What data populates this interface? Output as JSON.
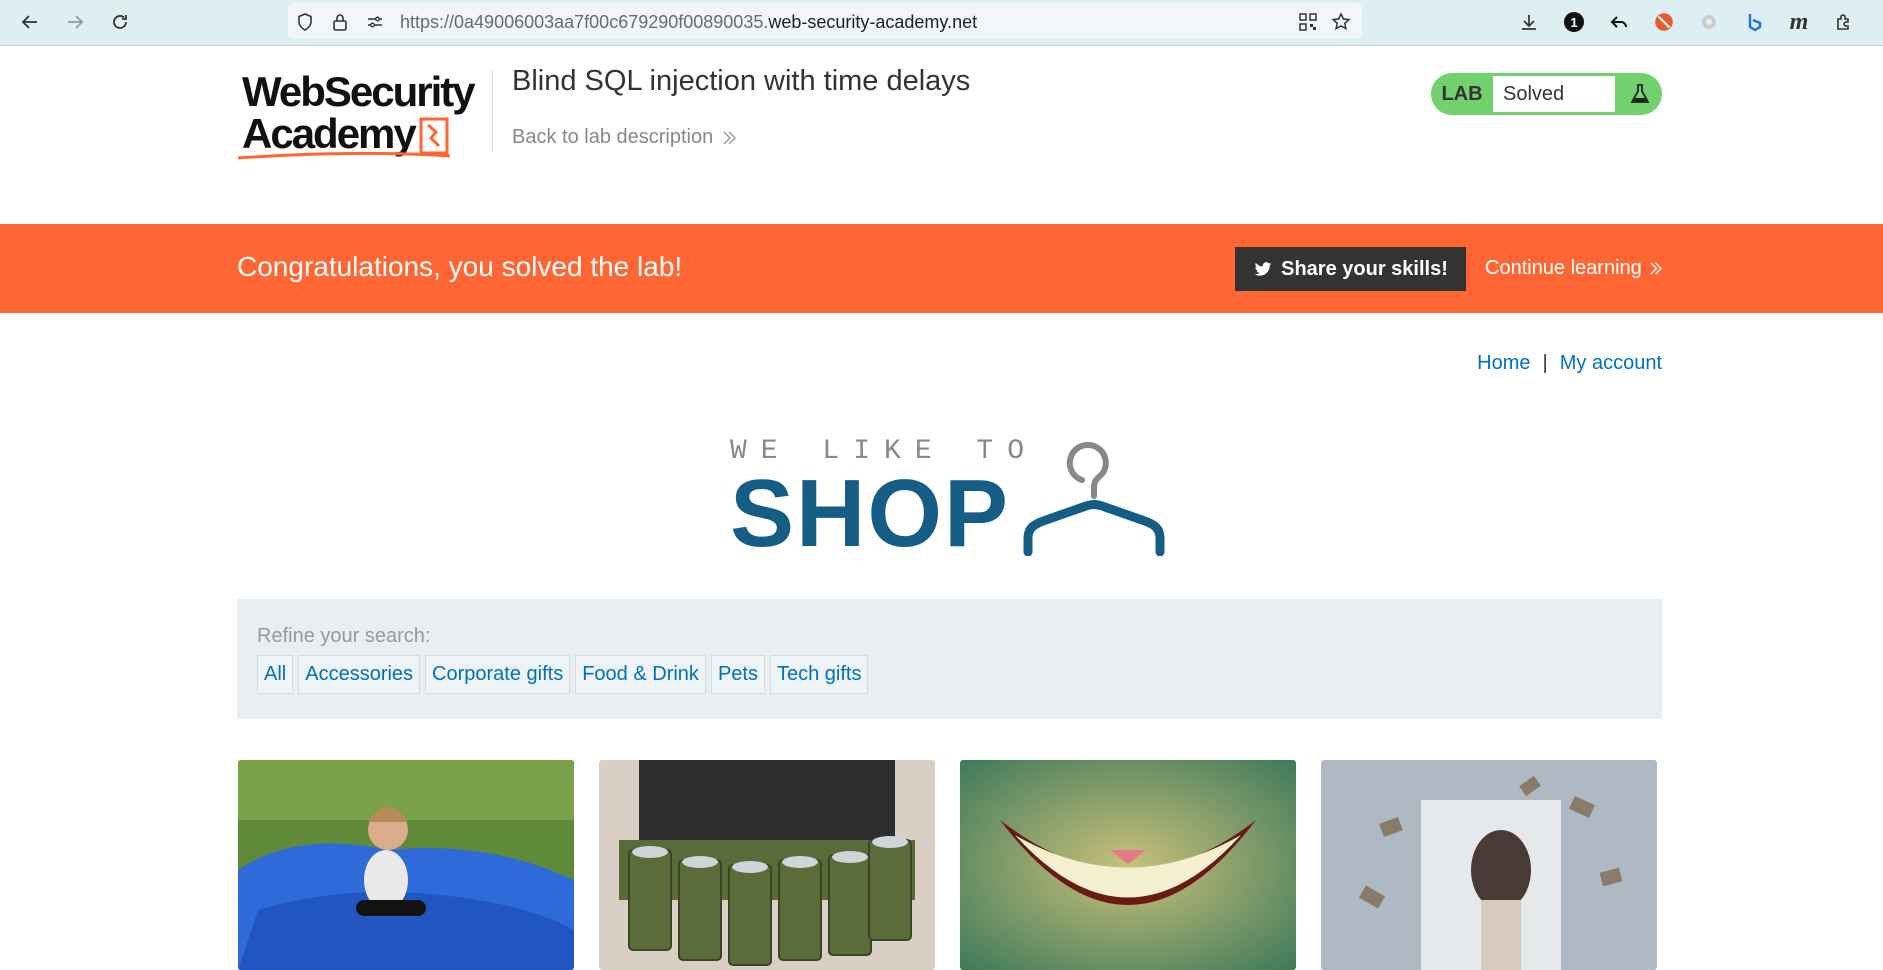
{
  "browser": {
    "url_prefix": "https://0a49006003aa7f00c679290f00890035.",
    "url_host": "web-security-academy.net",
    "badge_count": "1"
  },
  "header": {
    "logo_line1": "WebSecurity",
    "logo_line2": "Academy",
    "lab_title": "Blind SQL injection with time delays",
    "back_link": "Back to lab description",
    "lab_label": "LAB",
    "lab_status": "Solved"
  },
  "banner": {
    "message": "Congratulations, you solved the lab!",
    "share_label": "Share your skills!",
    "continue_label": "Continue learning"
  },
  "nav": {
    "home": "Home",
    "separator": "|",
    "my_account": "My account"
  },
  "shop_logo": {
    "tagline": "WE LIKE TO",
    "word": "SHOP"
  },
  "filter": {
    "label": "Refine your search:",
    "categories": [
      "All",
      "Accessories",
      "Corporate gifts",
      "Food & Drink",
      "Pets",
      "Tech gifts"
    ]
  },
  "colors": {
    "accent_orange": "#ff6633",
    "solved_green": "#70d16d",
    "link_blue": "#0071bc",
    "shop_blue": "#165d86"
  }
}
